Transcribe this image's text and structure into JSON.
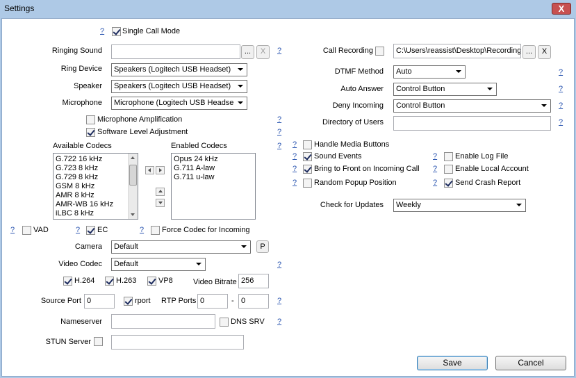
{
  "window": {
    "title": "Settings",
    "close": "X"
  },
  "help": "?",
  "single_call_mode": {
    "label": "Single Call Mode",
    "checked": true
  },
  "ringing_sound": {
    "label": "Ringing Sound",
    "value": "",
    "browse": "...",
    "clear": "X"
  },
  "ring_device": {
    "label": "Ring Device",
    "value": "Speakers (Logitech USB Headset)"
  },
  "speaker": {
    "label": "Speaker",
    "value": "Speakers (Logitech USB Headset)"
  },
  "microphone": {
    "label": "Microphone",
    "value": "Microphone (Logitech USB Headse"
  },
  "mic_amplification": {
    "label": "Microphone Amplification",
    "checked": false
  },
  "software_level": {
    "label": "Software Level Adjustment",
    "checked": true
  },
  "codecs": {
    "available_label": "Available Codecs",
    "enabled_label": "Enabled Codecs",
    "available": [
      "G.722 16 kHz",
      "G.723 8 kHz",
      "G.729 8 kHz",
      "GSM 8 kHz",
      "AMR 8 kHz",
      "AMR-WB 16 kHz",
      "iLBC 8 kHz"
    ],
    "enabled": [
      "Opus 24 kHz",
      "G.711 A-law",
      "G.711 u-law"
    ]
  },
  "vad": {
    "label": "VAD",
    "checked": false
  },
  "ec": {
    "label": "EC",
    "checked": true
  },
  "force_codec": {
    "label": "Force Codec for Incoming",
    "checked": false
  },
  "camera": {
    "label": "Camera",
    "value": "Default",
    "preview": "P"
  },
  "video_codec": {
    "label": "Video Codec",
    "value": "Default"
  },
  "h264": {
    "label": "H.264",
    "checked": true
  },
  "h263": {
    "label": "H.263",
    "checked": true
  },
  "vp8": {
    "label": "VP8",
    "checked": true
  },
  "video_bitrate": {
    "label": "Video Bitrate",
    "value": "256"
  },
  "source_port": {
    "label": "Source Port",
    "value": "0"
  },
  "rport": {
    "label": "rport",
    "checked": true
  },
  "rtp_ports": {
    "label": "RTP Ports",
    "from": "0",
    "dash": "-",
    "to": "0"
  },
  "nameserver": {
    "label": "Nameserver",
    "value": ""
  },
  "dns_srv": {
    "label": "DNS SRV",
    "checked": false
  },
  "stun_server": {
    "label": "STUN Server",
    "checked": false,
    "value": ""
  },
  "call_recording": {
    "label": "Call Recording",
    "checked": false,
    "path": "C:\\Users\\reassist\\Desktop\\Recording",
    "browse": "...",
    "clear": "X"
  },
  "dtmf": {
    "label": "DTMF Method",
    "value": "Auto"
  },
  "auto_answer": {
    "label": "Auto Answer",
    "value": "Control Button"
  },
  "deny_incoming": {
    "label": "Deny Incoming",
    "value": "Control Button"
  },
  "directory": {
    "label": "Directory of Users",
    "value": ""
  },
  "handle_media": {
    "label": "Handle Media Buttons",
    "checked": false
  },
  "sound_events": {
    "label": "Sound Events",
    "checked": true
  },
  "bring_front": {
    "label": "Bring to Front on Incoming Call",
    "checked": true
  },
  "random_popup": {
    "label": "Random Popup Position",
    "checked": false
  },
  "log_file": {
    "label": "Enable Log File",
    "checked": false
  },
  "local_account": {
    "label": "Enable Local Account",
    "checked": false
  },
  "crash_report": {
    "label": "Send Crash Report",
    "checked": true
  },
  "updates": {
    "label": "Check for Updates",
    "value": "Weekly"
  },
  "buttons": {
    "save": "Save",
    "cancel": "Cancel"
  }
}
